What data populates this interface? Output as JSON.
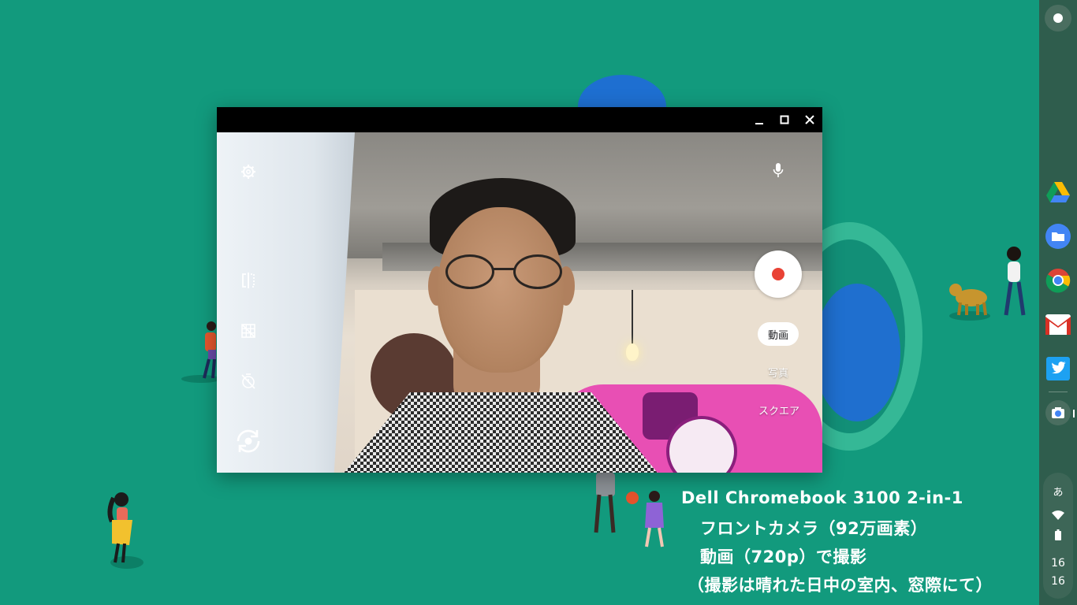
{
  "window": {
    "minimize_label": "minimize",
    "maximize_label": "maximize",
    "close_label": "close"
  },
  "camera": {
    "modes": [
      "動画",
      "写真",
      "スクエア"
    ],
    "active_mode": "動画",
    "shutter_state": "record"
  },
  "shelf": {
    "apps": [
      "Google Drive",
      "Files",
      "Chrome",
      "Gmail",
      "Twitter",
      "Camera"
    ],
    "ime": "あ",
    "time_hour": "16",
    "time_minute": "16"
  },
  "caption": {
    "line1": "Dell Chromebook 3100 2-in-1",
    "line2": "フロントカメラ（92万画素）",
    "line3": "動画（720p）で撮影",
    "line4": "（撮影は晴れた日中の室内、窓際にて）"
  },
  "colors": {
    "wallpaper": "#129a7d",
    "shelf": "#2f5d4d",
    "record_red": "#e94235"
  }
}
